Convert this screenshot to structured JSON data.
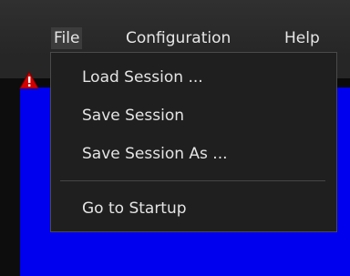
{
  "menubar": {
    "file": "File",
    "configuration": "Configuration",
    "help": "Help"
  },
  "file_menu": {
    "items": [
      "Load Session ...",
      "Save Session",
      "Save Session As ...",
      "Go to Startup"
    ]
  },
  "colors": {
    "canvas": "#0000ee",
    "menu_bg": "#1f1f1f",
    "warning": "#d40000"
  },
  "icons": {
    "warning": "warning-icon"
  }
}
